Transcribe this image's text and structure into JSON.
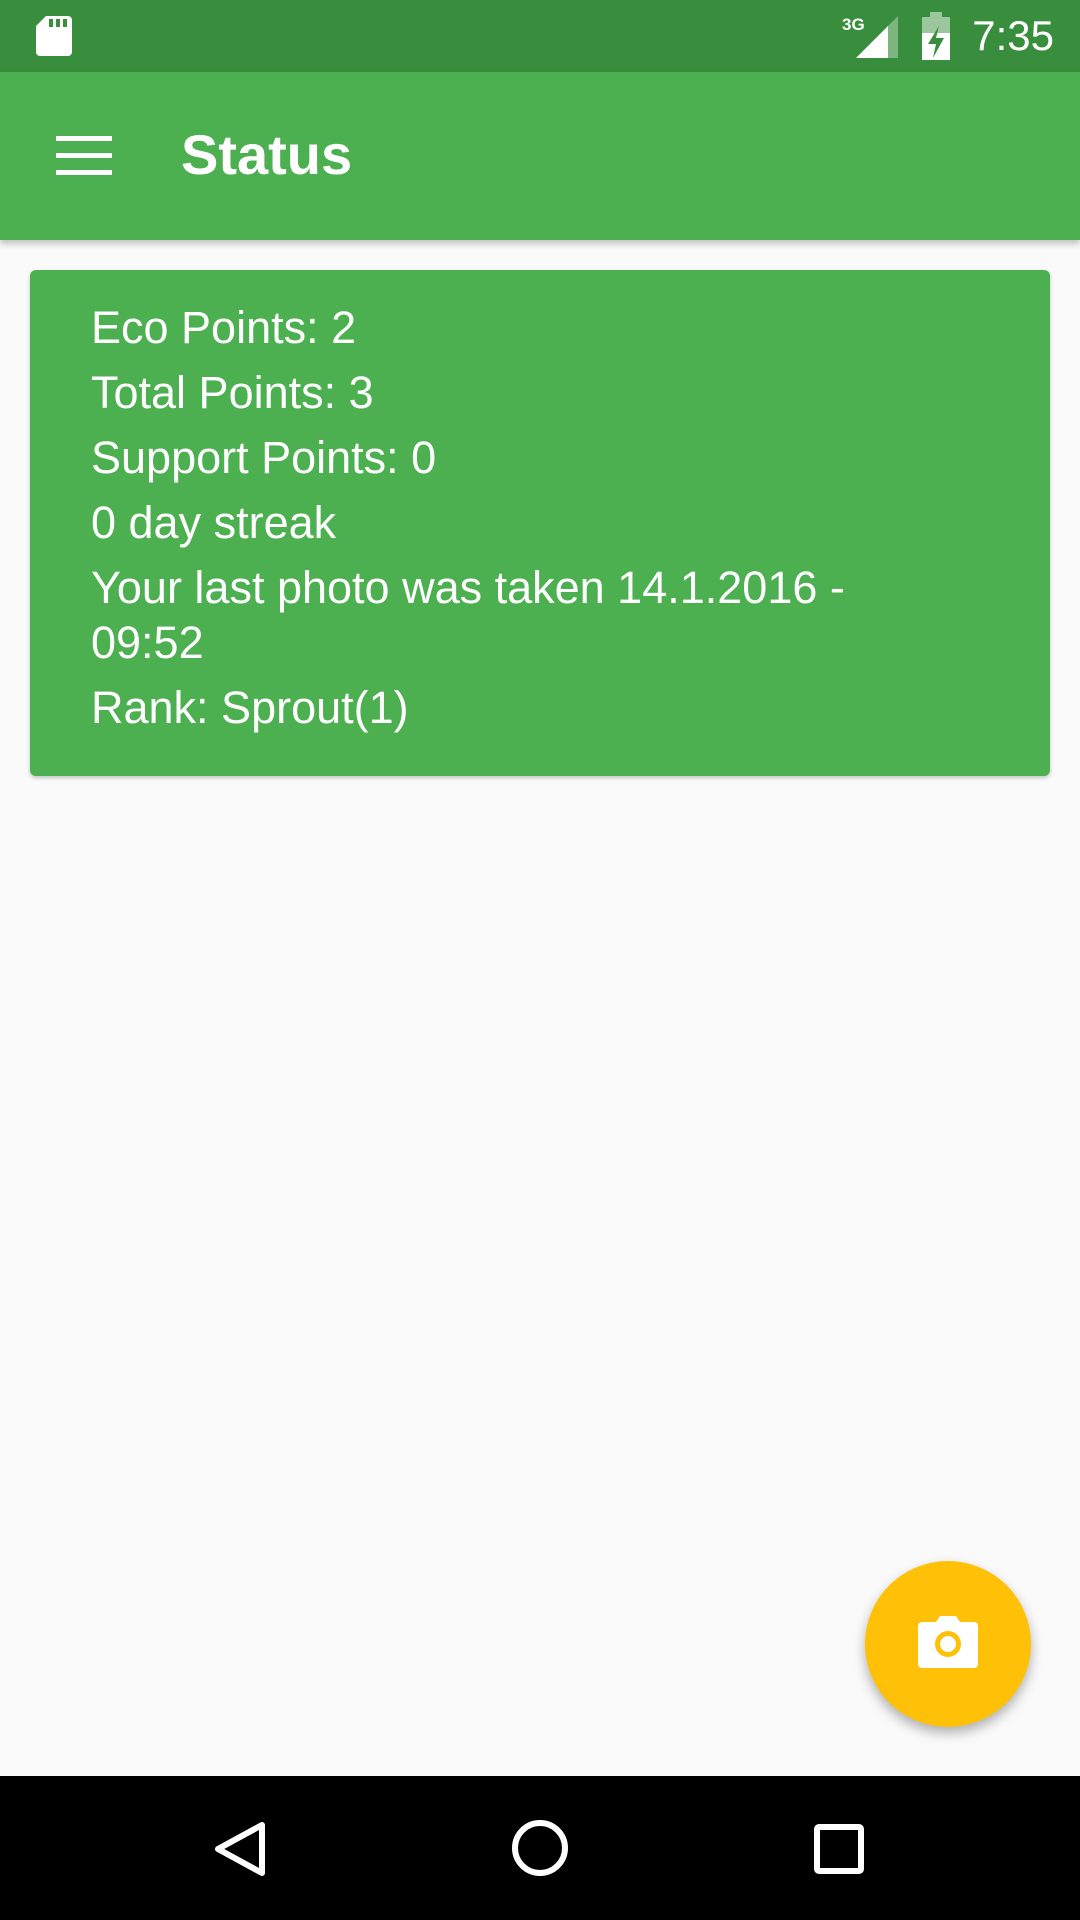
{
  "status_bar": {
    "network_label": "3G",
    "time": "7:35",
    "icons": [
      "sd-card-icon",
      "signal-3g-icon",
      "battery-charging-icon"
    ]
  },
  "app_bar": {
    "title": "Status",
    "menu_icon": "menu-icon"
  },
  "status_card": {
    "eco_points": "Eco Points: 2",
    "total_points": "Total Points: 3",
    "support_points": "Support Points: 0",
    "streak": "0 day streak",
    "last_photo": "Your last photo was taken 14.1.2016 - 09:52",
    "rank": "Rank: Sprout(1)"
  },
  "fab": {
    "icon": "camera-icon"
  },
  "nav_bar": {
    "icons": [
      "back-icon",
      "home-icon",
      "recents-icon"
    ]
  },
  "colors": {
    "status_bar": "#388e3c",
    "primary": "#4caf50",
    "accent": "#ffc107",
    "background": "#fafafa",
    "nav_bar": "#000000"
  }
}
